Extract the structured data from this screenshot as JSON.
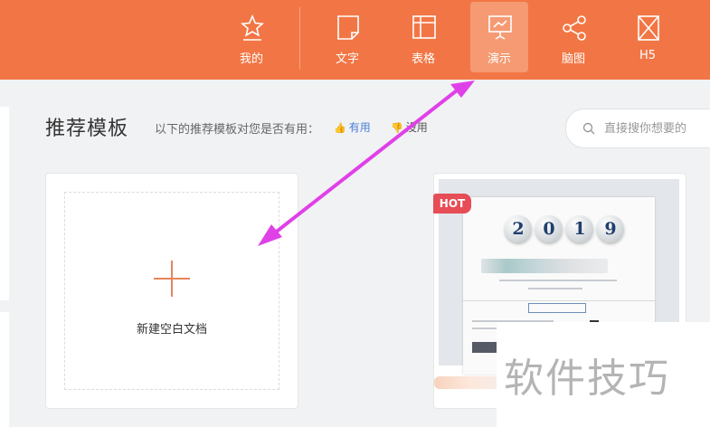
{
  "nav": {
    "tabs": [
      {
        "label": "我的",
        "icon": "star-icon",
        "active": false
      },
      {
        "label": "文字",
        "icon": "document-icon",
        "active": false
      },
      {
        "label": "表格",
        "icon": "spreadsheet-icon",
        "active": false
      },
      {
        "label": "演示",
        "icon": "presentation-icon",
        "active": true
      },
      {
        "label": "脑图",
        "icon": "mindmap-icon",
        "active": false
      },
      {
        "label": "H5",
        "icon": "h5-icon",
        "active": false
      }
    ]
  },
  "section": {
    "title": "推荐模板",
    "question": "以下的推荐模板对您是否有用：",
    "useful_label": "有用",
    "useless_label": "没用"
  },
  "search": {
    "placeholder": "直接搜你想要的"
  },
  "new_doc": {
    "label": "新建空白文档"
  },
  "template": {
    "badge": "HOT",
    "year_digits": [
      "2",
      "0",
      "1",
      "9"
    ]
  },
  "watermark": {
    "text": "软件技巧"
  },
  "colors": {
    "brand": "#f27645",
    "active_tab": "#f59a73",
    "arrow": "#e040e8",
    "hot_badge": "#e64d56",
    "useful_link": "#4a7fd6"
  }
}
